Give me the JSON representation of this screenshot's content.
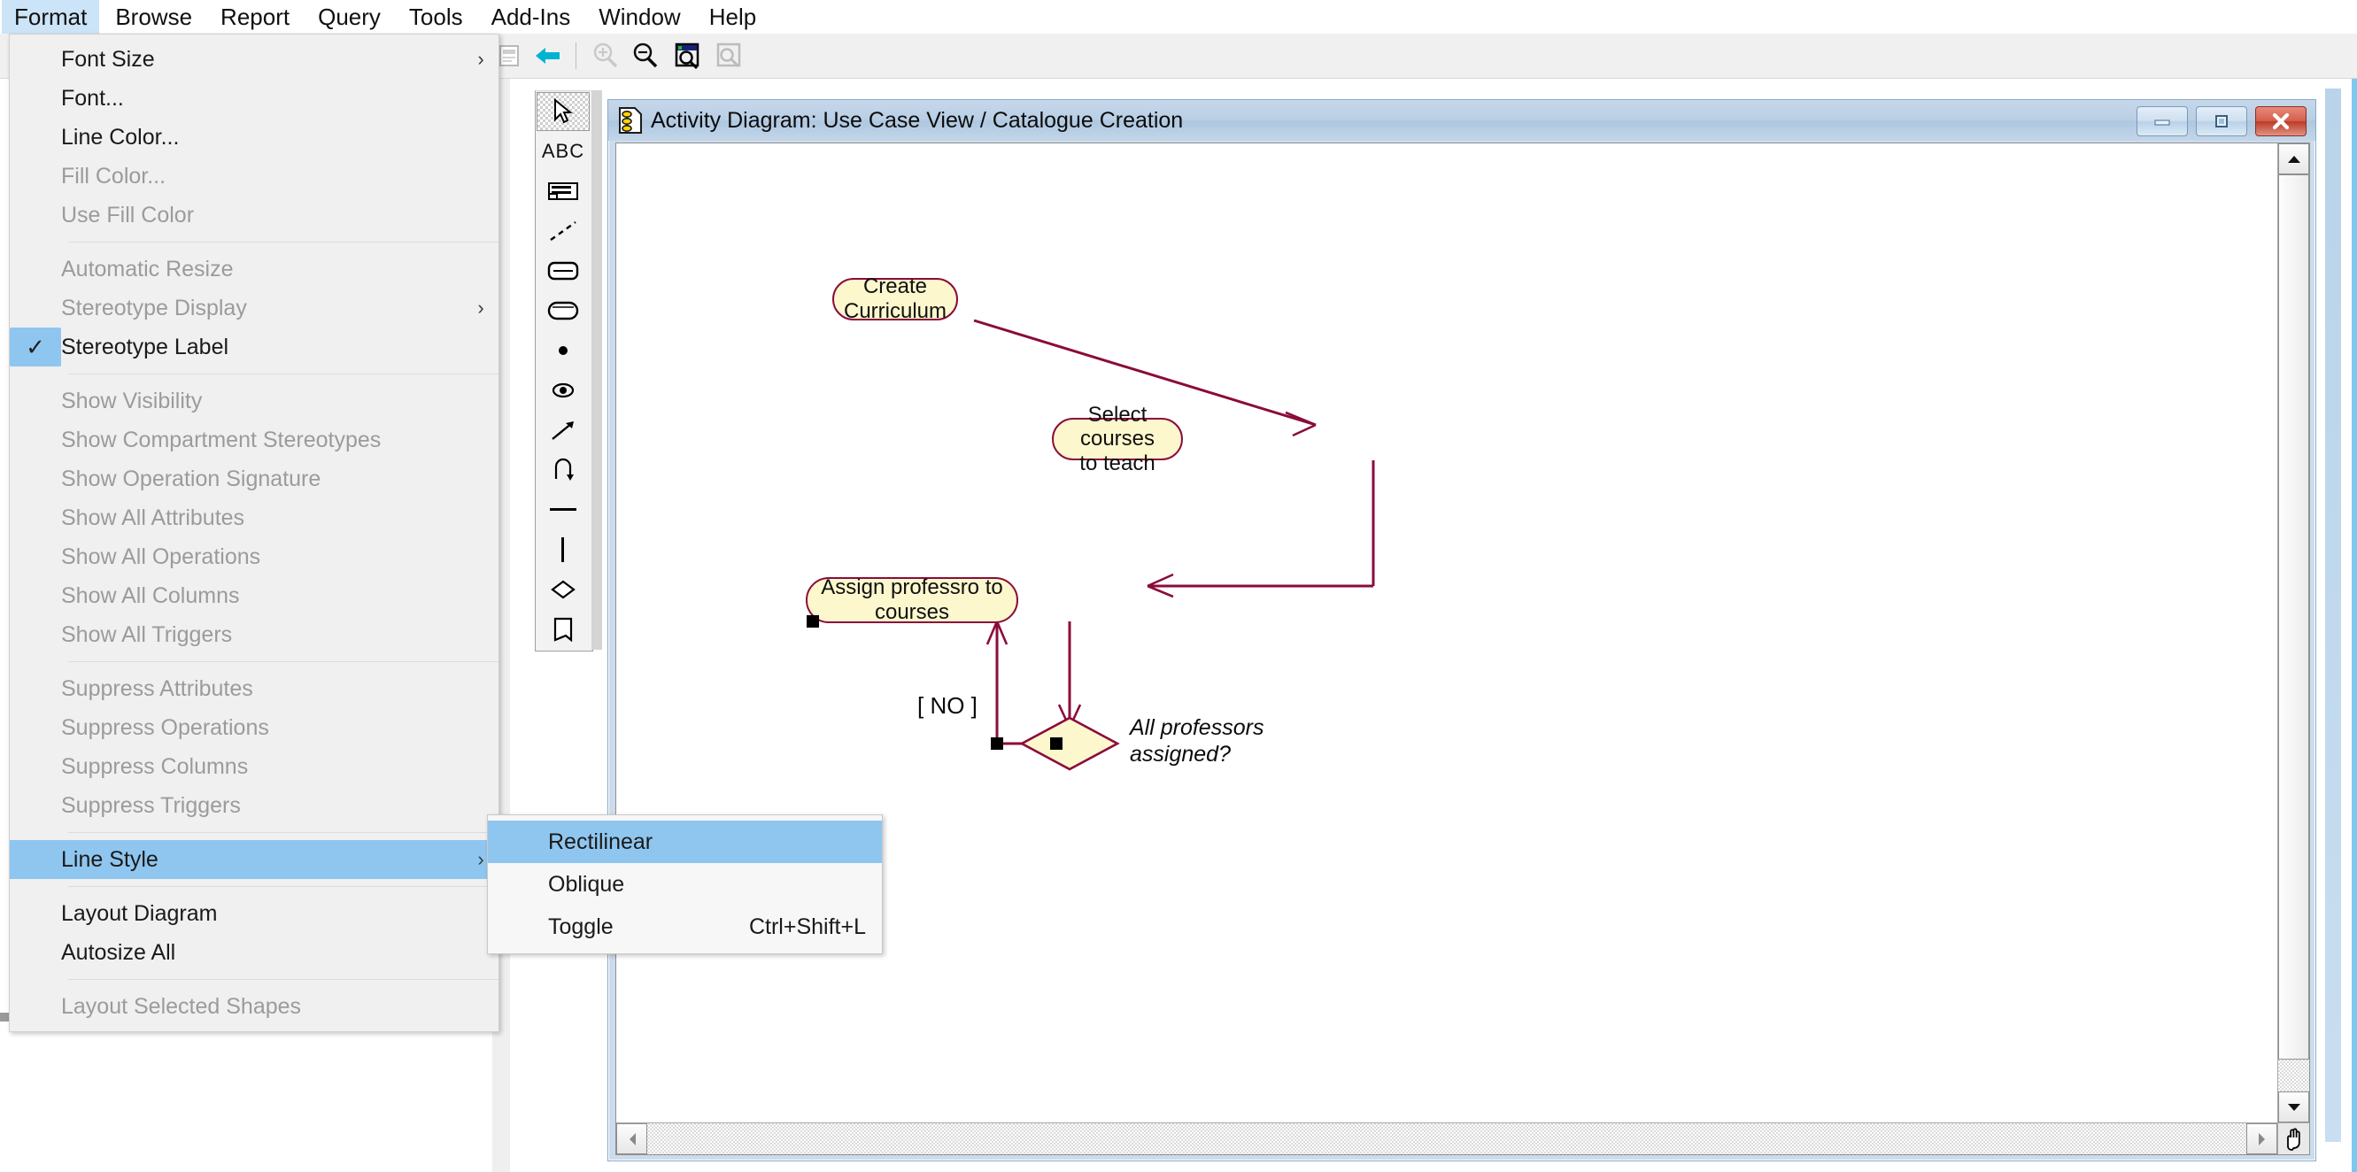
{
  "menubar": {
    "items": [
      {
        "label": "Format",
        "active": true
      },
      {
        "label": "Browse",
        "active": false
      },
      {
        "label": "Report",
        "active": false
      },
      {
        "label": "Query",
        "active": false
      },
      {
        "label": "Tools",
        "active": false
      },
      {
        "label": "Add-Ins",
        "active": false
      },
      {
        "label": "Window",
        "active": false
      },
      {
        "label": "Help",
        "active": false
      }
    ]
  },
  "toolbar": {
    "buttons": [
      {
        "name": "diagram-icon",
        "enabled": false
      },
      {
        "name": "back-arrow-icon",
        "enabled": true
      },
      {
        "name": "zoom-in-icon",
        "enabled": false
      },
      {
        "name": "zoom-out-icon",
        "enabled": true
      },
      {
        "name": "zoom-selection-icon",
        "enabled": true
      },
      {
        "name": "zoom-page-icon",
        "enabled": false
      }
    ]
  },
  "toolbox": {
    "tools": [
      {
        "name": "select-pointer-tool",
        "selected": true
      },
      {
        "name": "text-abc-tool",
        "selected": false
      },
      {
        "name": "note-tool",
        "selected": false
      },
      {
        "name": "note-anchor-tool",
        "selected": false
      },
      {
        "name": "state-tool",
        "selected": false
      },
      {
        "name": "activity-tool",
        "selected": false
      },
      {
        "name": "start-state-tool",
        "selected": false
      },
      {
        "name": "end-state-tool",
        "selected": false
      },
      {
        "name": "transition-tool",
        "selected": false
      },
      {
        "name": "transition-to-self-tool",
        "selected": false
      },
      {
        "name": "horizontal-synchronization-tool",
        "selected": false
      },
      {
        "name": "vertical-synchronization-tool",
        "selected": false
      },
      {
        "name": "decision-tool",
        "selected": false
      },
      {
        "name": "swimlane-tool",
        "selected": false
      }
    ]
  },
  "format_menu": {
    "items": [
      {
        "label": "Font Size",
        "enabled": true,
        "submenu": true,
        "checked": false,
        "highlight": false
      },
      {
        "label": "Font...",
        "enabled": true,
        "submenu": false,
        "checked": false,
        "highlight": false
      },
      {
        "label": "Line Color...",
        "enabled": true,
        "submenu": false,
        "checked": false,
        "highlight": false
      },
      {
        "label": "Fill Color...",
        "enabled": false,
        "submenu": false,
        "checked": false,
        "highlight": false
      },
      {
        "label": "Use Fill Color",
        "enabled": false,
        "submenu": false,
        "checked": false,
        "highlight": false
      },
      {
        "separator": true
      },
      {
        "label": "Automatic Resize",
        "enabled": false,
        "submenu": false,
        "checked": false,
        "highlight": false
      },
      {
        "label": "Stereotype Display",
        "enabled": false,
        "submenu": true,
        "checked": false,
        "highlight": false
      },
      {
        "label": "Stereotype Label",
        "enabled": true,
        "submenu": false,
        "checked": true,
        "highlight": false
      },
      {
        "separator": true
      },
      {
        "label": "Show Visibility",
        "enabled": false,
        "submenu": false,
        "checked": false,
        "highlight": false
      },
      {
        "label": "Show Compartment Stereotypes",
        "enabled": false,
        "submenu": false,
        "checked": false,
        "highlight": false
      },
      {
        "label": "Show Operation Signature",
        "enabled": false,
        "submenu": false,
        "checked": false,
        "highlight": false
      },
      {
        "label": "Show All Attributes",
        "enabled": false,
        "submenu": false,
        "checked": false,
        "highlight": false
      },
      {
        "label": "Show All Operations",
        "enabled": false,
        "submenu": false,
        "checked": false,
        "highlight": false
      },
      {
        "label": "Show All Columns",
        "enabled": false,
        "submenu": false,
        "checked": false,
        "highlight": false
      },
      {
        "label": "Show All Triggers",
        "enabled": false,
        "submenu": false,
        "checked": false,
        "highlight": false
      },
      {
        "separator": true
      },
      {
        "label": "Suppress Attributes",
        "enabled": false,
        "submenu": false,
        "checked": false,
        "highlight": false
      },
      {
        "label": "Suppress Operations",
        "enabled": false,
        "submenu": false,
        "checked": false,
        "highlight": false
      },
      {
        "label": "Suppress Columns",
        "enabled": false,
        "submenu": false,
        "checked": false,
        "highlight": false
      },
      {
        "label": "Suppress Triggers",
        "enabled": false,
        "submenu": false,
        "checked": false,
        "highlight": false
      },
      {
        "separator": true
      },
      {
        "label": "Line Style",
        "enabled": true,
        "submenu": true,
        "checked": false,
        "highlight": true
      },
      {
        "separator": true
      },
      {
        "label": "Layout Diagram",
        "enabled": true,
        "submenu": false,
        "checked": false,
        "highlight": false
      },
      {
        "label": "Autosize All",
        "enabled": true,
        "submenu": false,
        "checked": false,
        "highlight": false
      },
      {
        "separator": true
      },
      {
        "label": "Layout Selected Shapes",
        "enabled": false,
        "submenu": false,
        "checked": false,
        "highlight": false
      }
    ],
    "checkmark_glyph": "✓",
    "submenu_arrow_glyph": "›"
  },
  "line_style_submenu": {
    "items": [
      {
        "label": "Rectilinear",
        "accel": "",
        "highlight": true
      },
      {
        "label": "Oblique",
        "accel": "",
        "highlight": false
      },
      {
        "label": "Toggle",
        "accel": "Ctrl+Shift+L",
        "highlight": false
      }
    ]
  },
  "diagram_window": {
    "title": "Activity Diagram: Use Case View / Catalogue Creation",
    "minimize_label": "–",
    "maximize_label": "□",
    "close_label": "✕"
  },
  "diagram": {
    "colors": {
      "node_fill": "#fcf7cd",
      "node_border": "#8b0b3c",
      "edge": "#8b0b3c",
      "canvas": "#ffffff",
      "selection_handle": "#000000"
    },
    "nodes": [
      {
        "id": "create-curriculum",
        "label": "Create\nCurriculum",
        "shape": "activity"
      },
      {
        "id": "select-courses",
        "label": "Select courses\nto teach",
        "shape": "activity"
      },
      {
        "id": "assign-professors",
        "label": "Assign professro to\ncourses",
        "shape": "activity",
        "selected": true
      },
      {
        "id": "all-assigned",
        "label": "",
        "shape": "decision",
        "selected": true
      }
    ],
    "labels": [
      {
        "id": "no-guard",
        "text": "[ NO ]",
        "italic": false
      },
      {
        "id": "decision-question",
        "text": "All professors\nassigned?",
        "italic": true
      }
    ]
  }
}
